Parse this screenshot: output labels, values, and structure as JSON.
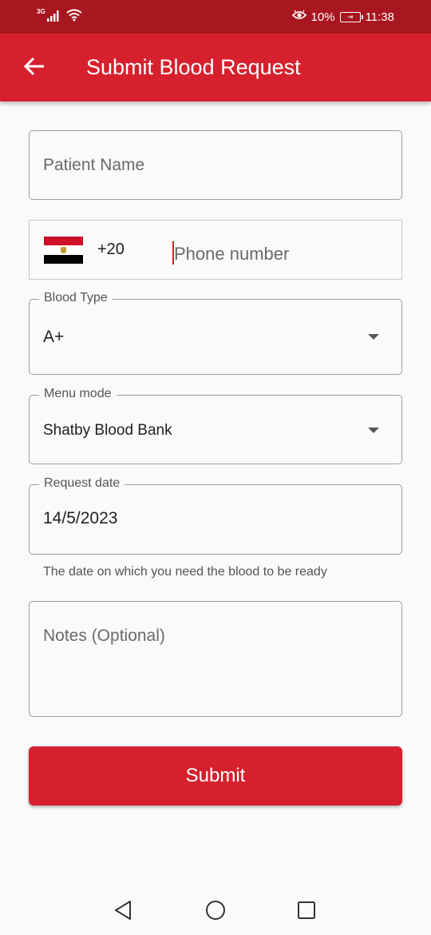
{
  "status_bar": {
    "network": "3G",
    "battery_percent": "10%",
    "time": "11:38",
    "icons": [
      "signal-icon",
      "wifi-icon",
      "eye-comfort-icon",
      "battery-charging-icon"
    ]
  },
  "app_bar": {
    "title": "Submit Blood Request",
    "back_icon": "arrow-left-icon"
  },
  "form": {
    "patient_name": {
      "placeholder": "Patient Name",
      "value": ""
    },
    "phone": {
      "country": "Egypt",
      "flag_icon": "egypt-flag-icon",
      "dial_code": "+20",
      "placeholder": "Phone number",
      "value": ""
    },
    "blood_type": {
      "label": "Blood Type",
      "value": "A+"
    },
    "menu_mode": {
      "label": "Menu mode",
      "value": "Shatby Blood Bank"
    },
    "request_date": {
      "label": "Request date",
      "value": "14/5/2023",
      "helper": "The date on which you need the blood to be ready"
    },
    "notes": {
      "placeholder": "Notes (Optional)",
      "value": ""
    },
    "submit_label": "Submit"
  },
  "nav_bar": {
    "icons": [
      "back-triangle-icon",
      "home-circle-icon",
      "recents-square-icon"
    ]
  },
  "colors": {
    "status_bar": "#a8161f",
    "primary": "#d7202e",
    "background": "#fafafa"
  }
}
